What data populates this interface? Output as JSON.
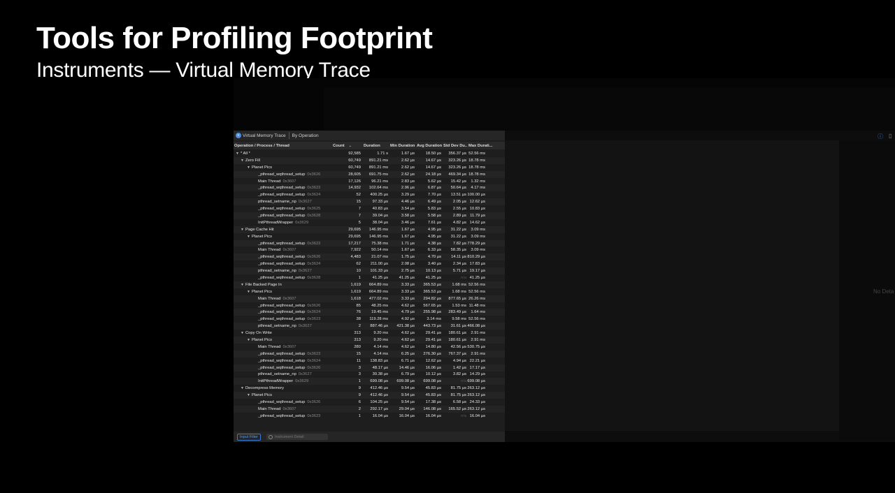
{
  "slide": {
    "title": "Tools for Profiling Footprint",
    "subtitle": "Instruments — Virtual Memory Trace"
  },
  "breadcrumb": {
    "instrument": "Virtual Memory Trace",
    "view": "By Operation"
  },
  "columns": {
    "name": "Operation / Process / Thread",
    "count": "Count",
    "duration": "Duration",
    "min": "Min Duration",
    "avg": "Avg Duration",
    "std": "Std Dev Du...",
    "max": "Max Durati..."
  },
  "rows": [
    {
      "level": 0,
      "tri": "▼",
      "name": "* All *",
      "tid": "",
      "count": "92,585",
      "dur": "1.71 s",
      "min": "1.67 µs",
      "avg": "18.50 µs",
      "std": "356.37 µs",
      "max": "52.56 ms"
    },
    {
      "level": 1,
      "tri": "▼",
      "name": "Zero Fill",
      "tid": "",
      "count": "60,749",
      "dur": "891.21 ms",
      "min": "2.62 µs",
      "avg": "14.67 µs",
      "std": "323.26 µs",
      "max": "18.78 ms"
    },
    {
      "level": 2,
      "tri": "▼",
      "name": "Planet Pics",
      "tid": "",
      "count": "60,749",
      "dur": "891.21 ms",
      "min": "2.62 µs",
      "avg": "14.67 µs",
      "std": "323.26 µs",
      "max": "18.78 ms"
    },
    {
      "level": 3,
      "tri": "",
      "name": "_pthread_wqthread_setup",
      "tid": "0x3626",
      "count": "28,605",
      "dur": "691.75 ms",
      "min": "2.62 µs",
      "avg": "24.18 µs",
      "std": "469.34 µs",
      "max": "18.78 ms"
    },
    {
      "level": 3,
      "tri": "",
      "name": "Main Thread",
      "tid": "0x3607",
      "count": "17,126",
      "dur": "96.21 ms",
      "min": "2.83 µs",
      "avg": "5.62 µs",
      "std": "15.42 µs",
      "max": "1.32 ms"
    },
    {
      "level": 3,
      "tri": "",
      "name": "_pthread_wqthread_setup",
      "tid": "0x3623",
      "count": "14,932",
      "dur": "102.64 ms",
      "min": "2.96 µs",
      "avg": "6.87 µs",
      "std": "50.64 µs",
      "max": "4.17 ms"
    },
    {
      "level": 3,
      "tri": "",
      "name": "_pthread_wqthread_setup",
      "tid": "0x3624",
      "count": "52",
      "dur": "400.25 µs",
      "min": "3.29 µs",
      "avg": "7.70 µs",
      "std": "13.51 µs",
      "max": "100.00 µs"
    },
    {
      "level": 3,
      "tri": "",
      "name": "pthread_setname_np",
      "tid": "0x3627",
      "count": "15",
      "dur": "97.33 µs",
      "min": "4.46 µs",
      "avg": "6.49 µs",
      "std": "2.05 µs",
      "max": "12.62 µs"
    },
    {
      "level": 3,
      "tri": "",
      "name": "_pthread_wqthread_setup",
      "tid": "0x3625",
      "count": "7",
      "dur": "40.83 µs",
      "min": "3.54 µs",
      "avg": "5.83 µs",
      "std": "2.55 µs",
      "max": "10.83 µs"
    },
    {
      "level": 3,
      "tri": "",
      "name": "_pthread_wqthread_setup",
      "tid": "0x3628",
      "count": "7",
      "dur": "39.04 µs",
      "min": "3.58 µs",
      "avg": "5.58 µs",
      "std": "2.89 µs",
      "max": "11.79 µs"
    },
    {
      "level": 3,
      "tri": "",
      "name": "InitPthreadWrapper",
      "tid": "0x3629",
      "count": "5",
      "dur": "38.04 µs",
      "min": "3.46 µs",
      "avg": "7.61 µs",
      "std": "4.82 µs",
      "max": "14.62 µs"
    },
    {
      "level": 1,
      "tri": "▼",
      "name": "Page Cache Hit",
      "tid": "",
      "count": "29,695",
      "dur": "146.95 ms",
      "min": "1.67 µs",
      "avg": "4.95 µs",
      "std": "31.22 µs",
      "max": "3.09 ms"
    },
    {
      "level": 2,
      "tri": "▼",
      "name": "Planet Pics",
      "tid": "",
      "count": "29,695",
      "dur": "146.95 ms",
      "min": "1.67 µs",
      "avg": "4.95 µs",
      "std": "31.22 µs",
      "max": "3.09 ms"
    },
    {
      "level": 3,
      "tri": "",
      "name": "_pthread_wqthread_setup",
      "tid": "0x3623",
      "count": "17,217",
      "dur": "75.38 ms",
      "min": "1.71 µs",
      "avg": "4.38 µs",
      "std": "7.82 µs",
      "max": "778.29 µs"
    },
    {
      "level": 3,
      "tri": "",
      "name": "Main Thread",
      "tid": "0x3607",
      "count": "7,922",
      "dur": "50.14 ms",
      "min": "1.67 µs",
      "avg": "6.33 µs",
      "std": "58.35 µs",
      "max": "3.09 ms"
    },
    {
      "level": 3,
      "tri": "",
      "name": "_pthread_wqthread_setup",
      "tid": "0x3626",
      "count": "4,483",
      "dur": "21.07 ms",
      "min": "1.75 µs",
      "avg": "4.70 µs",
      "std": "14.11 µs",
      "max": "810.29 µs"
    },
    {
      "level": 3,
      "tri": "",
      "name": "_pthread_wqthread_setup",
      "tid": "0x3624",
      "count": "62",
      "dur": "211.00 µs",
      "min": "2.08 µs",
      "avg": "3.40 µs",
      "std": "2.34 µs",
      "max": "17.83 µs"
    },
    {
      "level": 3,
      "tri": "",
      "name": "pthread_setname_np",
      "tid": "0x3627",
      "count": "10",
      "dur": "101.33 µs",
      "min": "2.75 µs",
      "avg": "10.13 µs",
      "std": "5.71 µs",
      "max": "19.17 µs"
    },
    {
      "level": 3,
      "tri": "",
      "name": "_pthread_wqthread_setup",
      "tid": "0x3628",
      "count": "1",
      "dur": "41.25 µs",
      "min": "41.25 µs",
      "avg": "41.25 µs",
      "std": "n/a",
      "max": "41.25 µs"
    },
    {
      "level": 1,
      "tri": "▼",
      "name": "File Backed Page In",
      "tid": "",
      "count": "1,619",
      "dur": "664.89 ms",
      "min": "3.33 µs",
      "avg": "365.53 µs",
      "std": "1.68 ms",
      "max": "52.56 ms"
    },
    {
      "level": 2,
      "tri": "▼",
      "name": "Planet Pics",
      "tid": "",
      "count": "1,619",
      "dur": "664.89 ms",
      "min": "3.33 µs",
      "avg": "365.53 µs",
      "std": "1.68 ms",
      "max": "52.56 ms"
    },
    {
      "level": 3,
      "tri": "",
      "name": "Main Thread",
      "tid": "0x3607",
      "count": "1,618",
      "dur": "477.02 ms",
      "min": "3.33 µs",
      "avg": "294.82 µs",
      "std": "877.65 µs",
      "max": "26.26 ms"
    },
    {
      "level": 3,
      "tri": "",
      "name": "_pthread_wqthread_setup",
      "tid": "0x3626",
      "count": "85",
      "dur": "48.25 ms",
      "min": "4.62 µs",
      "avg": "567.65 µs",
      "std": "1.53 ms",
      "max": "11.48 ms"
    },
    {
      "level": 3,
      "tri": "",
      "name": "_pthread_wqthread_setup",
      "tid": "0x3624",
      "count": "76",
      "dur": "19.45 ms",
      "min": "4.79 µs",
      "avg": "255.98 µs",
      "std": "283.49 µs",
      "max": "1.64 ms"
    },
    {
      "level": 3,
      "tri": "",
      "name": "_pthread_wqthread_setup",
      "tid": "0x3623",
      "count": "38",
      "dur": "119.28 ms",
      "min": "4.92 µs",
      "avg": "3.14 ms",
      "std": "9.58 ms",
      "max": "52.56 ms"
    },
    {
      "level": 3,
      "tri": "",
      "name": "pthread_setname_np",
      "tid": "0x3627",
      "count": "2",
      "dur": "887.46 µs",
      "min": "421.38 µs",
      "avg": "443.73 µs",
      "std": "31.61 µs",
      "max": "466.08 µs"
    },
    {
      "level": 1,
      "tri": "▼",
      "name": "Copy On Write",
      "tid": "",
      "count": "313",
      "dur": "9.20 ms",
      "min": "4.62 µs",
      "avg": "29.41 µs",
      "std": "180.61 µs",
      "max": "2.91 ms"
    },
    {
      "level": 2,
      "tri": "▼",
      "name": "Planet Pics",
      "tid": "",
      "count": "313",
      "dur": "9.20 ms",
      "min": "4.62 µs",
      "avg": "29.41 µs",
      "std": "180.61 µs",
      "max": "2.91 ms"
    },
    {
      "level": 3,
      "tri": "",
      "name": "Main Thread",
      "tid": "0x3607",
      "count": "280",
      "dur": "4.14 ms",
      "min": "4.62 µs",
      "avg": "14.80 µs",
      "std": "42.56 µs",
      "max": "530.75 µs"
    },
    {
      "level": 3,
      "tri": "",
      "name": "_pthread_wqthread_setup",
      "tid": "0x3623",
      "count": "15",
      "dur": "4.14 ms",
      "min": "6.25 µs",
      "avg": "276.30 µs",
      "std": "767.37 µs",
      "max": "2.91 ms"
    },
    {
      "level": 3,
      "tri": "",
      "name": "_pthread_wqthread_setup",
      "tid": "0x3624",
      "count": "11",
      "dur": "138.83 µs",
      "min": "6.71 µs",
      "avg": "12.62 µs",
      "std": "4.94 µs",
      "max": "22.21 µs"
    },
    {
      "level": 3,
      "tri": "",
      "name": "_pthread_wqthread_setup",
      "tid": "0x3626",
      "count": "3",
      "dur": "48.17 µs",
      "min": "14.46 µs",
      "avg": "16.06 µs",
      "std": "1.42 µs",
      "max": "17.17 µs"
    },
    {
      "level": 3,
      "tri": "",
      "name": "pthread_setname_np",
      "tid": "0x3627",
      "count": "3",
      "dur": "30.38 µs",
      "min": "6.79 µs",
      "avg": "10.12 µs",
      "std": "3.82 µs",
      "max": "14.29 µs"
    },
    {
      "level": 3,
      "tri": "",
      "name": "InitPthreadWrapper",
      "tid": "0x3629",
      "count": "1",
      "dur": "699.08 µs",
      "min": "699.08 µs",
      "avg": "699.08 µs",
      "std": "n/a",
      "max": "699.08 µs"
    },
    {
      "level": 1,
      "tri": "▼",
      "name": "Decompress Memory",
      "tid": "",
      "count": "9",
      "dur": "412.46 µs",
      "min": "9.54 µs",
      "avg": "45.83 µs",
      "std": "81.75 µs",
      "max": "263.12 µs"
    },
    {
      "level": 2,
      "tri": "▼",
      "name": "Planet Pics",
      "tid": "",
      "count": "9",
      "dur": "412.46 µs",
      "min": "9.54 µs",
      "avg": "45.83 µs",
      "std": "81.75 µs",
      "max": "263.12 µs"
    },
    {
      "level": 3,
      "tri": "",
      "name": "_pthread_wqthread_setup",
      "tid": "0x3626",
      "count": "6",
      "dur": "104.25 µs",
      "min": "9.54 µs",
      "avg": "17.38 µs",
      "std": "6.58 µs",
      "max": "24.33 µs"
    },
    {
      "level": 3,
      "tri": "",
      "name": "Main Thread",
      "tid": "0x3607",
      "count": "2",
      "dur": "292.17 µs",
      "min": "29.04 µs",
      "avg": "146.08 µs",
      "std": "165.52 µs",
      "max": "263.12 µs"
    },
    {
      "level": 3,
      "tri": "",
      "name": "_pthread_wqthread_setup",
      "tid": "0x3623",
      "count": "1",
      "dur": "16.04 µs",
      "min": "16.04 µs",
      "avg": "16.04 µs",
      "std": "n/a",
      "max": "16.04 µs"
    }
  ],
  "footer": {
    "filter": "Input Filter",
    "detail_placeholder": "Instrument Detail"
  },
  "right": {
    "no_detail": "No Deta"
  }
}
